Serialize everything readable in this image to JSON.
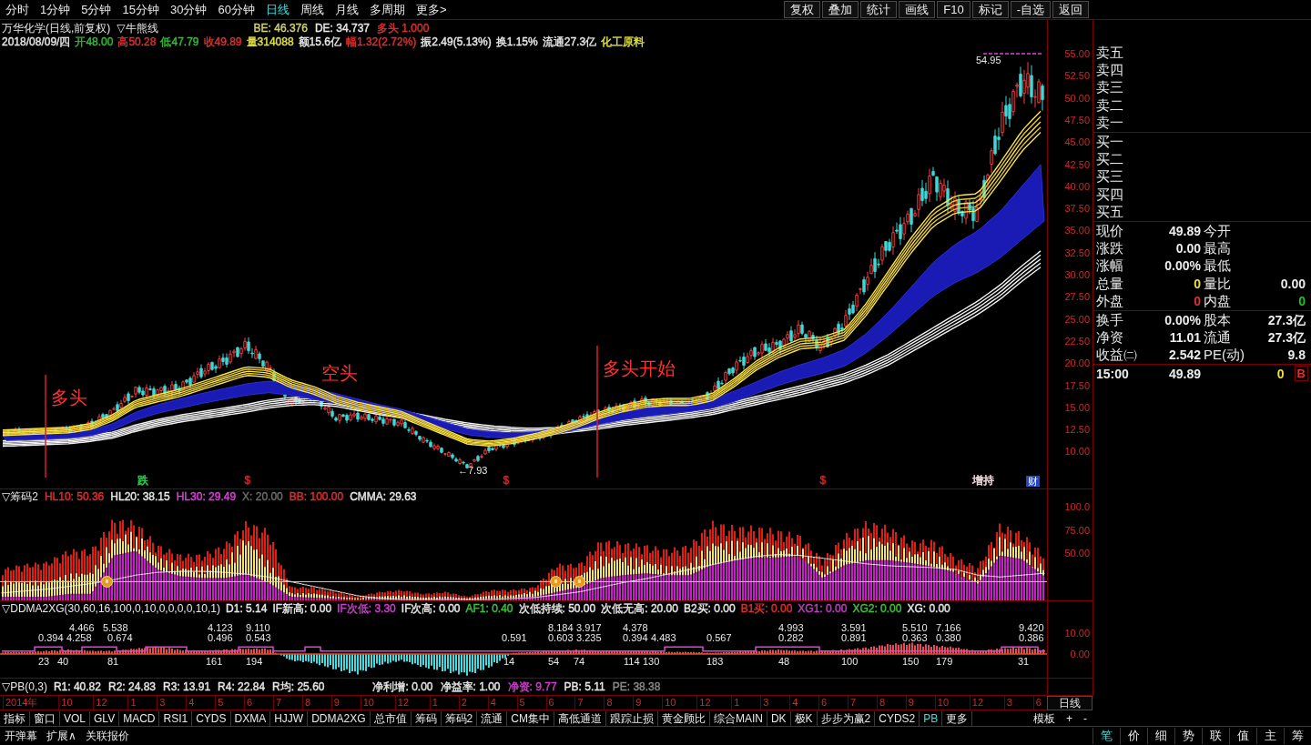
{
  "toolbar": {
    "periods": [
      {
        "label": "分时",
        "selected": false
      },
      {
        "label": "1分钟",
        "selected": false
      },
      {
        "label": "5分钟",
        "selected": false
      },
      {
        "label": "15分钟",
        "selected": false
      },
      {
        "label": "30分钟",
        "selected": false
      },
      {
        "label": "60分钟",
        "selected": false
      },
      {
        "label": "日线",
        "selected": true
      },
      {
        "label": "周线",
        "selected": false
      },
      {
        "label": "月线",
        "selected": false
      },
      {
        "label": "多周期",
        "selected": false
      },
      {
        "label": "更多>",
        "selected": false
      }
    ],
    "actions": [
      "复权",
      "叠加",
      "统计",
      "画线",
      "F10",
      "标记",
      "-自选",
      "返回"
    ]
  },
  "main_chart": {
    "title": "万华化学(日线,前复权)",
    "indicator": "▽牛熊线",
    "indicator_values": [
      {
        "text": "BE: 46.376",
        "color": "#d2d27a"
      },
      {
        "text": "DE: 34.737",
        "color": "#e8e8e8"
      },
      {
        "text": "多头 1.000",
        "color": "#e03030"
      }
    ],
    "bar_info": [
      {
        "text": "2018/08/09/四",
        "color": "#e8e8e8"
      },
      {
        "text": "开48.00",
        "color": "#30c030"
      },
      {
        "text": "高50.28",
        "color": "#e03030"
      },
      {
        "text": "低47.79",
        "color": "#30c030"
      },
      {
        "text": "收49.89",
        "color": "#e03030"
      },
      {
        "text": "量314088",
        "color": "#e0e040"
      },
      {
        "text": "额15.6亿",
        "color": "#e8e8e8"
      },
      {
        "text": "幅1.32(2.72%)",
        "color": "#e03030"
      },
      {
        "text": "振2.49(5.13%)",
        "color": "#e8e8e8"
      },
      {
        "text": "换1.15%",
        "color": "#e8e8e8"
      },
      {
        "text": "流通27.3亿",
        "color": "#e8e8e8"
      },
      {
        "text": "化工原料",
        "color": "#e0e040"
      }
    ],
    "price_axis": [
      "55.00",
      "52.50",
      "50.00",
      "47.50",
      "45.00",
      "42.50",
      "40.00",
      "37.50",
      "35.00",
      "32.50",
      "30.00",
      "27.50",
      "25.00",
      "22.50",
      "20.00",
      "17.50",
      "15.00",
      "12.50",
      "10.00"
    ],
    "phase_notes": [
      {
        "text": "多头",
        "line": true
      },
      {
        "text": "空头",
        "line": false
      },
      {
        "text": "多头开始",
        "line": true
      }
    ],
    "high_label": "54.95",
    "low_label": "←7.93",
    "events": [
      {
        "kind": "text",
        "text": "跌",
        "color": "#30d050"
      },
      {
        "kind": "text",
        "text": "$",
        "color": "#e02020"
      },
      {
        "kind": "text",
        "text": "$",
        "color": "#e02020"
      },
      {
        "kind": "text",
        "text": "$",
        "color": "#e02020"
      },
      {
        "kind": "text",
        "text": "增持",
        "color": "#f2dede"
      },
      {
        "kind": "badge",
        "text": "财",
        "color": "#2448c8"
      }
    ]
  },
  "chip_panel": {
    "name": "▽筹码2",
    "values": [
      {
        "text": "HL10: 50.36",
        "color": "#e03030"
      },
      {
        "text": "HL20: 38.15",
        "color": "#e8e8e8"
      },
      {
        "text": "HL30: 29.49",
        "color": "#e040e0"
      },
      {
        "text": "X: 20.00",
        "color": "#6e6e6e"
      },
      {
        "text": "BB: 100.00",
        "color": "#e03030"
      },
      {
        "text": "CMMA: 29.63",
        "color": "#e8e8e8"
      }
    ],
    "axis": [
      "100.0",
      "75.00",
      "50.00"
    ]
  },
  "ddma_panel": {
    "name": "▽DDMA2XG(30,60,16,100,0,10,0,0,0,0,10,1)",
    "values": [
      {
        "text": "D1: 5.14",
        "color": "#e8e8e8"
      },
      {
        "text": "IF新高: 0.00",
        "color": "#e8e8e8"
      },
      {
        "text": "IF次低: 3.30",
        "color": "#d040d0"
      },
      {
        "text": "IF次高: 0.00",
        "color": "#e8e8e8"
      },
      {
        "text": "AF1: 0.40",
        "color": "#40c040"
      },
      {
        "text": "次低持续: 50.00",
        "color": "#e8e8e8"
      },
      {
        "text": "次低无高: 20.00",
        "color": "#e8e8e8"
      },
      {
        "text": "B2买: 0.00",
        "color": "#e8e8e8"
      },
      {
        "text": "B1买: 0.00",
        "color": "#e03030"
      },
      {
        "text": "XG1: 0.00",
        "color": "#c040c0"
      },
      {
        "text": "XG2: 0.00",
        "color": "#40c040"
      },
      {
        "text": "XG: 0.00",
        "color": "#e8e8e8"
      }
    ],
    "axis": [
      "10.00",
      "0.00"
    ],
    "labels": [
      {
        "kind": "peak",
        "text": "4.466"
      },
      {
        "kind": "peak",
        "text": "5.538"
      },
      {
        "kind": "peak",
        "text": "4.123"
      },
      {
        "kind": "peak",
        "text": "9.110"
      },
      {
        "kind": "peak",
        "text": "8.184"
      },
      {
        "kind": "peak",
        "text": "3.917"
      },
      {
        "kind": "peak",
        "text": "4.378"
      },
      {
        "kind": "peak",
        "text": "4.993"
      },
      {
        "kind": "peak",
        "text": "3.591"
      },
      {
        "kind": "peak",
        "text": "5.510"
      },
      {
        "kind": "peak",
        "text": "7.166"
      },
      {
        "kind": "peak",
        "text": "9.420"
      },
      {
        "kind": "trough",
        "text": "0.394"
      },
      {
        "kind": "trough",
        "text": "4.258"
      },
      {
        "kind": "trough",
        "text": "0.674"
      },
      {
        "kind": "trough",
        "text": "0.496"
      },
      {
        "kind": "trough",
        "text": "0.543"
      },
      {
        "kind": "trough",
        "text": "0.591"
      },
      {
        "kind": "trough",
        "text": "0.603"
      },
      {
        "kind": "trough",
        "text": "3.235"
      },
      {
        "kind": "trough",
        "text": "0.394"
      },
      {
        "kind": "trough",
        "text": "4.483"
      },
      {
        "kind": "trough",
        "text": "0.567"
      },
      {
        "kind": "trough",
        "text": "0.282"
      },
      {
        "kind": "trough",
        "text": "0.891"
      },
      {
        "kind": "trough",
        "text": "0.363"
      },
      {
        "kind": "trough",
        "text": "0.380"
      },
      {
        "kind": "trough",
        "text": "0.386"
      },
      {
        "kind": "count",
        "text": "23"
      },
      {
        "kind": "count",
        "text": "40"
      },
      {
        "kind": "count",
        "text": "81"
      },
      {
        "kind": "count",
        "text": "161"
      },
      {
        "kind": "count",
        "text": "194"
      },
      {
        "kind": "count",
        "text": "14"
      },
      {
        "kind": "count",
        "text": "54"
      },
      {
        "kind": "count",
        "text": "74"
      },
      {
        "kind": "count",
        "text": "114"
      },
      {
        "kind": "count",
        "text": "130"
      },
      {
        "kind": "count",
        "text": "183"
      },
      {
        "kind": "count",
        "text": "48"
      },
      {
        "kind": "count",
        "text": "100"
      },
      {
        "kind": "count",
        "text": "150"
      },
      {
        "kind": "count",
        "text": "179"
      },
      {
        "kind": "count",
        "text": "31"
      }
    ]
  },
  "pb_panel": {
    "name": "▽PB(0,3)",
    "value_groups": [
      [
        {
          "text": "R1: 40.82",
          "color": "#e8e8e8"
        },
        {
          "text": "R2: 24.83",
          "color": "#e8e8e8"
        },
        {
          "text": "R3: 13.91",
          "color": "#e8e8e8"
        },
        {
          "text": "R4: 22.84",
          "color": "#e8e8e8"
        },
        {
          "text": "R均: 25.60",
          "color": "#e8e8e8"
        }
      ],
      [
        {
          "text": "净利增: 0.00",
          "color": "#e8e8e8"
        },
        {
          "text": "净益率: 1.00",
          "color": "#e8e8e8"
        },
        {
          "text": "净资: 9.77",
          "color": "#d040d0"
        },
        {
          "text": "PB: 5.11",
          "color": "#e8e8e8"
        },
        {
          "text": "PE: 38.38",
          "color": "#8a8a8a"
        }
      ]
    ]
  },
  "time_axis": {
    "labels": [
      "2014年",
      "10",
      "12",
      "1",
      "3",
      "4",
      "5",
      "6",
      "7",
      "8",
      "9",
      "10",
      "12",
      "1",
      "2",
      "4",
      "5",
      "6",
      "7",
      "8",
      "9",
      "10",
      "12",
      "1",
      "3",
      "4",
      "6",
      "7",
      "8",
      "9",
      "10",
      "12",
      "3",
      "6"
    ],
    "period": "日线"
  },
  "indicator_tabs": {
    "tabs": [
      {
        "label": "指标",
        "selected": false
      },
      {
        "label": "窗口",
        "selected": false
      },
      {
        "label": "VOL",
        "selected": false
      },
      {
        "label": "GLV",
        "selected": false
      },
      {
        "label": "MACD",
        "selected": false
      },
      {
        "label": "RSI1",
        "selected": false
      },
      {
        "label": "CYDS",
        "selected": false
      },
      {
        "label": "DXMA",
        "selected": false
      },
      {
        "label": "HJJW",
        "selected": false
      },
      {
        "label": "DDMA2XG",
        "selected": false
      },
      {
        "label": "总市值",
        "selected": false
      },
      {
        "label": "筹码",
        "selected": false
      },
      {
        "label": "筹码2",
        "selected": false
      },
      {
        "label": "流通",
        "selected": false
      },
      {
        "label": "CM集中",
        "selected": false
      },
      {
        "label": "高低通道",
        "selected": false
      },
      {
        "label": "跟踪止损",
        "selected": false
      },
      {
        "label": "黄金顾比",
        "selected": false
      },
      {
        "label": "综合MAIN",
        "selected": false
      },
      {
        "label": "DK",
        "selected": false
      },
      {
        "label": "极K",
        "selected": false
      },
      {
        "label": "步步为赢2",
        "selected": false
      },
      {
        "label": "CYDS2",
        "selected": false
      },
      {
        "label": "PB",
        "selected": true
      },
      {
        "label": "更多",
        "selected": false
      }
    ],
    "actions": [
      "模板",
      "+",
      "-"
    ]
  },
  "quote_panel": {
    "asks": [
      "卖五",
      "卖四",
      "卖三",
      "卖二",
      "卖一"
    ],
    "bids": [
      "买一",
      "买二",
      "买三",
      "买四",
      "买五"
    ],
    "stat_groups": [
      [
        {
          "cells": [
            {
              "label": "现价",
              "value": "49.89"
            },
            {
              "label": "今开"
            }
          ]
        },
        {
          "cells": [
            {
              "label": "涨跌",
              "value": "0.00"
            },
            {
              "label": "最高"
            }
          ]
        },
        {
          "cells": [
            {
              "label": "涨幅",
              "value": "0.00%"
            },
            {
              "label": "最低"
            }
          ]
        },
        {
          "cells": [
            {
              "label": "总量",
              "value": "0",
              "color": "#e8e040"
            },
            {
              "label": "量比",
              "value": "0.00"
            }
          ]
        },
        {
          "cells": [
            {
              "label": "外盘",
              "value": "0",
              "color": "#e03030"
            },
            {
              "label": "内盘",
              "value": "0",
              "color": "#20c020"
            }
          ]
        }
      ],
      [
        {
          "cells": [
            {
              "label": "换手",
              "value": "0.00%"
            },
            {
              "label": "股本",
              "value": "27.3亿"
            }
          ]
        },
        {
          "cells": [
            {
              "label": "净资",
              "value": "11.01"
            },
            {
              "label": "流通",
              "value": "27.3亿"
            }
          ]
        },
        {
          "cells": [
            {
              "label": "收益㈡",
              "value": "2.542"
            },
            {
              "label": "PE(动)",
              "value": "9.8"
            }
          ]
        }
      ]
    ],
    "last_trade": {
      "time": "15:00",
      "price": "49.89",
      "volume": {
        "text": "0",
        "color": "#e8e040"
      },
      "side": {
        "text": "B",
        "color": "#e03030"
      }
    }
  },
  "bottom_bar": {
    "links": [
      "开弹幕",
      "扩展∧",
      "关联报价"
    ],
    "view_tabs": [
      {
        "label": "笔",
        "selected": true
      },
      {
        "label": "价",
        "selected": false
      },
      {
        "label": "细",
        "selected": false
      },
      {
        "label": "势",
        "selected": false
      },
      {
        "label": "联",
        "selected": false
      },
      {
        "label": "值",
        "selected": false
      },
      {
        "label": "主",
        "selected": false
      },
      {
        "label": "筹",
        "selected": false
      }
    ]
  }
}
